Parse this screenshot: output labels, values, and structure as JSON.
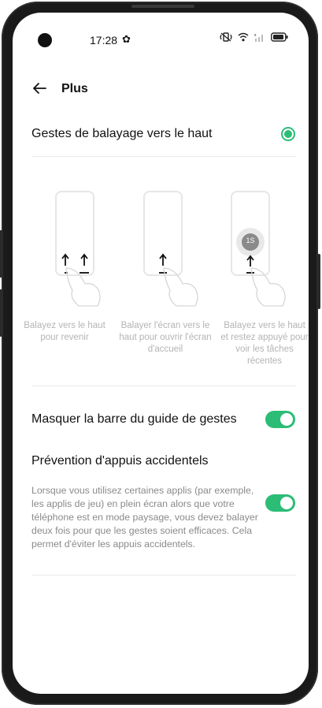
{
  "status_bar": {
    "time": "17:28"
  },
  "header": {
    "title": "Plus"
  },
  "swipe_option": {
    "label": "Gestes de balayage vers le haut",
    "selected": true
  },
  "gestures": [
    {
      "caption": "Balayez vers le haut pour revenir"
    },
    {
      "caption": "Balayer l'écran vers le haut pour ouvrir l'écran d'accueil"
    },
    {
      "caption": "Balayez vers le haut et restez appuyé pour voir les tâches récentes",
      "badge": "1S"
    }
  ],
  "hide_guide_bar": {
    "label": "Masquer la barre du guide de gestes",
    "enabled": true
  },
  "accidental_prevention": {
    "label": "Prévention d'appuis accidentels",
    "description": "Lorsque vous utilisez certaines applis (par exemple, les applis de jeu) en plein écran alors que votre téléphone est en mode paysage, vous devez balayer deux fois pour que les gestes soient efficaces. Cela permet d'éviter les appuis accidentels.",
    "enabled": true
  },
  "colors": {
    "accent": "#2bbd76",
    "caption": "#b4b4b4",
    "description": "#8a8a8a"
  }
}
